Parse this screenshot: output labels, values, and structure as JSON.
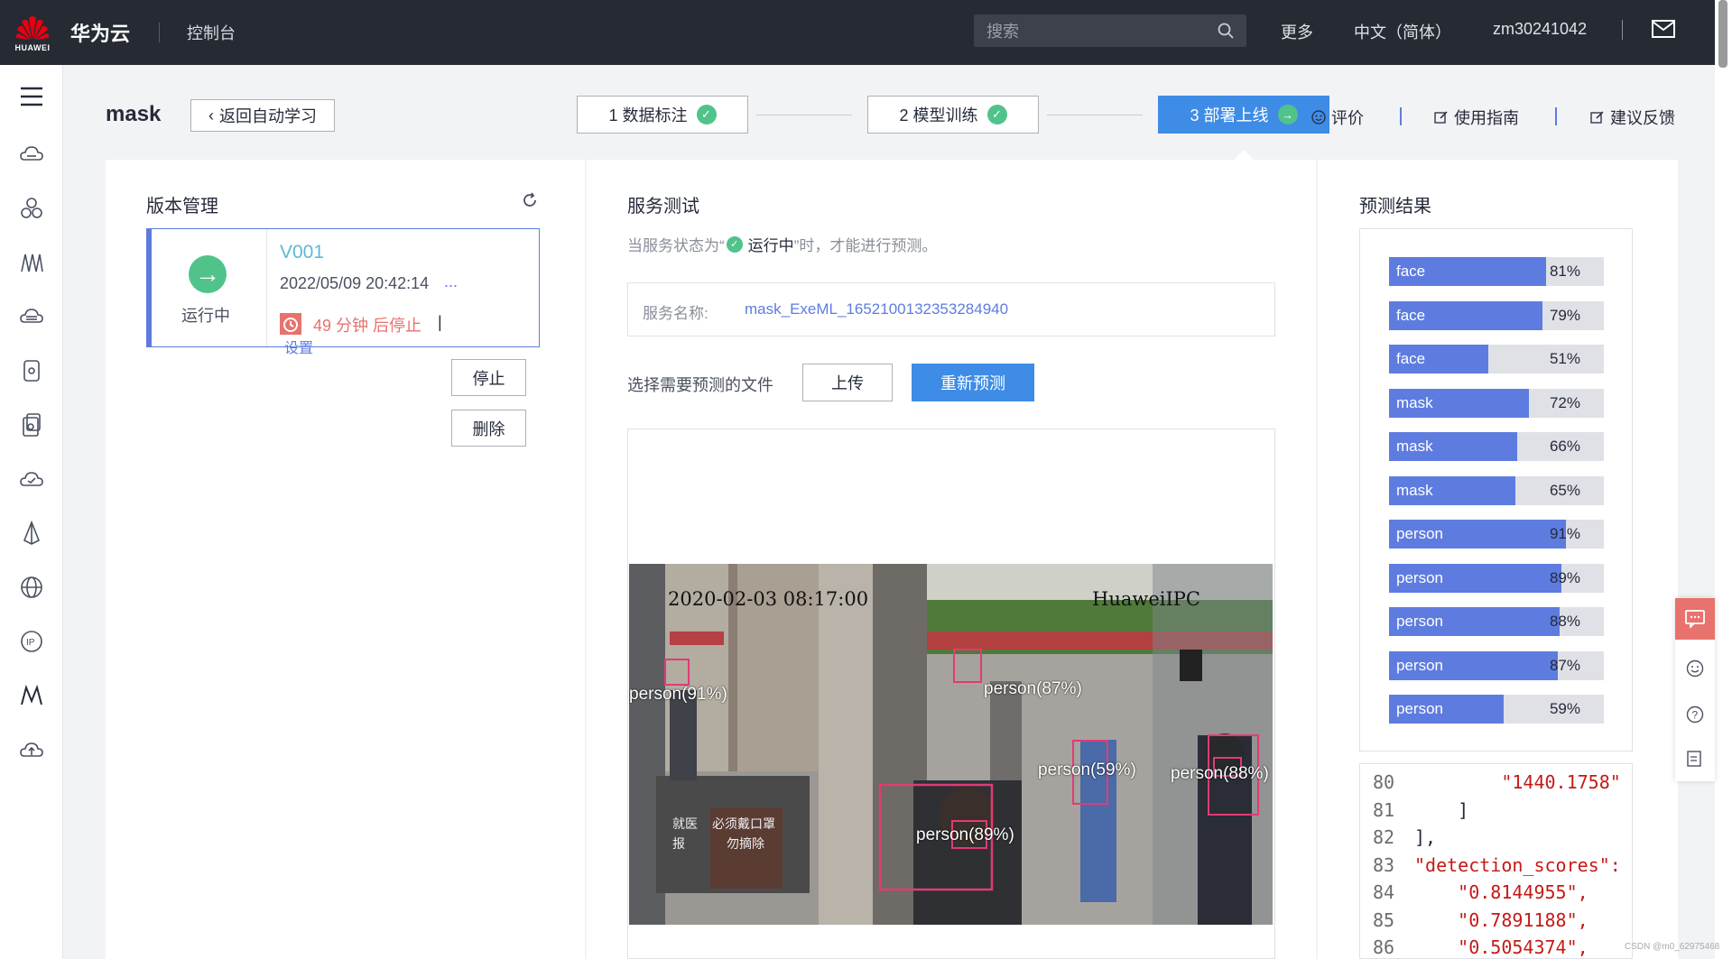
{
  "topbar": {
    "logo_text": "HUAWEI",
    "brand": "华为云",
    "console": "控制台",
    "search_placeholder": "搜索",
    "more": "更多",
    "language": "中文（简体）",
    "username": "zm30241042"
  },
  "header": {
    "title": "mask",
    "back_label": "返回自动学习",
    "steps": [
      {
        "label": "1 数据标注",
        "state": "done"
      },
      {
        "label": "2 模型训练",
        "state": "done"
      },
      {
        "label": "3 部署上线",
        "state": "active"
      }
    ],
    "evaluate": "评价",
    "guide": "使用指南",
    "feedback": "建议反馈"
  },
  "version": {
    "title": "版本管理",
    "status": "运行中",
    "name": "V001",
    "time": "2022/05/09 20:42:14",
    "more": "...",
    "stop_note": "49 分钟 后停止",
    "stop_sep": "|",
    "settings": "设置",
    "stop_button": "停止",
    "delete_button": "删除"
  },
  "service": {
    "title": "服务测试",
    "hint_prefix": "当服务状态为“",
    "hint_status": "运行中",
    "hint_suffix": "”时，才能进行预测。",
    "name_label": "服务名称:",
    "name_value": "mask_ExeML_1652100132353284940",
    "file_label": "选择需要预测的文件",
    "upload": "上传",
    "repredict": "重新预测",
    "image_timestamp": "2020-02-03  08:17:00",
    "image_camera": "HuaweiIPC",
    "detections": [
      {
        "label": "person(91%)"
      },
      {
        "label": "person(87%)"
      },
      {
        "label": "person(89%)"
      },
      {
        "label": "person(59%)"
      },
      {
        "label": "person(88%)"
      }
    ],
    "sign_left": "就医",
    "sign_left2": "报",
    "sign_right": "必须戴口罩",
    "sign_right2": "勿摘除"
  },
  "results": {
    "title": "预测结果",
    "bars": [
      {
        "label": "face",
        "value": 81,
        "pct": "81%"
      },
      {
        "label": "face",
        "value": 79,
        "pct": "79%"
      },
      {
        "label": "face",
        "value": 51,
        "pct": "51%"
      },
      {
        "label": "mask",
        "value": 72,
        "pct": "72%"
      },
      {
        "label": "mask",
        "value": 66,
        "pct": "66%"
      },
      {
        "label": "mask",
        "value": 65,
        "pct": "65%"
      },
      {
        "label": "person",
        "value": 91,
        "pct": "91%"
      },
      {
        "label": "person",
        "value": 89,
        "pct": "89%"
      },
      {
        "label": "person",
        "value": 88,
        "pct": "88%"
      },
      {
        "label": "person",
        "value": 87,
        "pct": "87%"
      },
      {
        "label": "person",
        "value": 59,
        "pct": "59%"
      }
    ],
    "code": [
      {
        "n": "80",
        "t": "        \"1440.1758\""
      },
      {
        "n": "81",
        "t": "    ]"
      },
      {
        "n": "82",
        "t": "],"
      },
      {
        "n": "83",
        "t": "\"detection_scores\":"
      },
      {
        "n": "84",
        "t": "    \"0.8144955\","
      },
      {
        "n": "85",
        "t": "    \"0.7891188\","
      },
      {
        "n": "86",
        "t": "    \"0.5054374\","
      }
    ]
  },
  "watermark": "CSDN @m0_62975468",
  "colors": {
    "primary": "#5e7ce0",
    "active_step": "#3e8ce6",
    "success": "#50c38a",
    "danger": "#e8726d",
    "topbar": "#262a33"
  }
}
